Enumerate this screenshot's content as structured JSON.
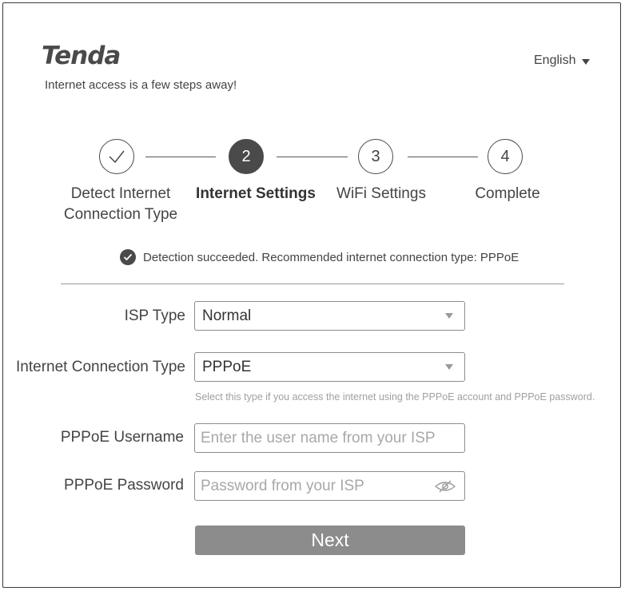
{
  "header": {
    "logo_text": "Tenda",
    "tagline": "Internet access is a few steps away!",
    "language": "English"
  },
  "steps": [
    {
      "number": "",
      "label_line1": "Detect Internet",
      "label_line2": "Connection Type",
      "state": "done"
    },
    {
      "number": "2",
      "label_line1": "Internet Settings",
      "label_line2": "",
      "state": "active"
    },
    {
      "number": "3",
      "label_line1": "WiFi Settings",
      "label_line2": "",
      "state": "pending"
    },
    {
      "number": "4",
      "label_line1": "Complete",
      "label_line2": "",
      "state": "pending"
    }
  ],
  "notice": "Detection succeeded. Recommended internet connection type: PPPoE",
  "form": {
    "isp_type": {
      "label": "ISP Type",
      "value": "Normal"
    },
    "connection_type": {
      "label": "Internet Connection Type",
      "value": "PPPoE",
      "hint": "Select this type if you access the internet using the PPPoE account and PPPoE password."
    },
    "username": {
      "label": "PPPoE Username",
      "placeholder": "Enter the user name from your ISP"
    },
    "password": {
      "label": "PPPoE Password",
      "placeholder": "Password from your ISP"
    },
    "next_label": "Next"
  },
  "colors": {
    "primary_dark": "#4a4a4a",
    "button_bg": "#8c8c8c",
    "border": "#8c8c8c",
    "placeholder": "#a8a8a8"
  }
}
